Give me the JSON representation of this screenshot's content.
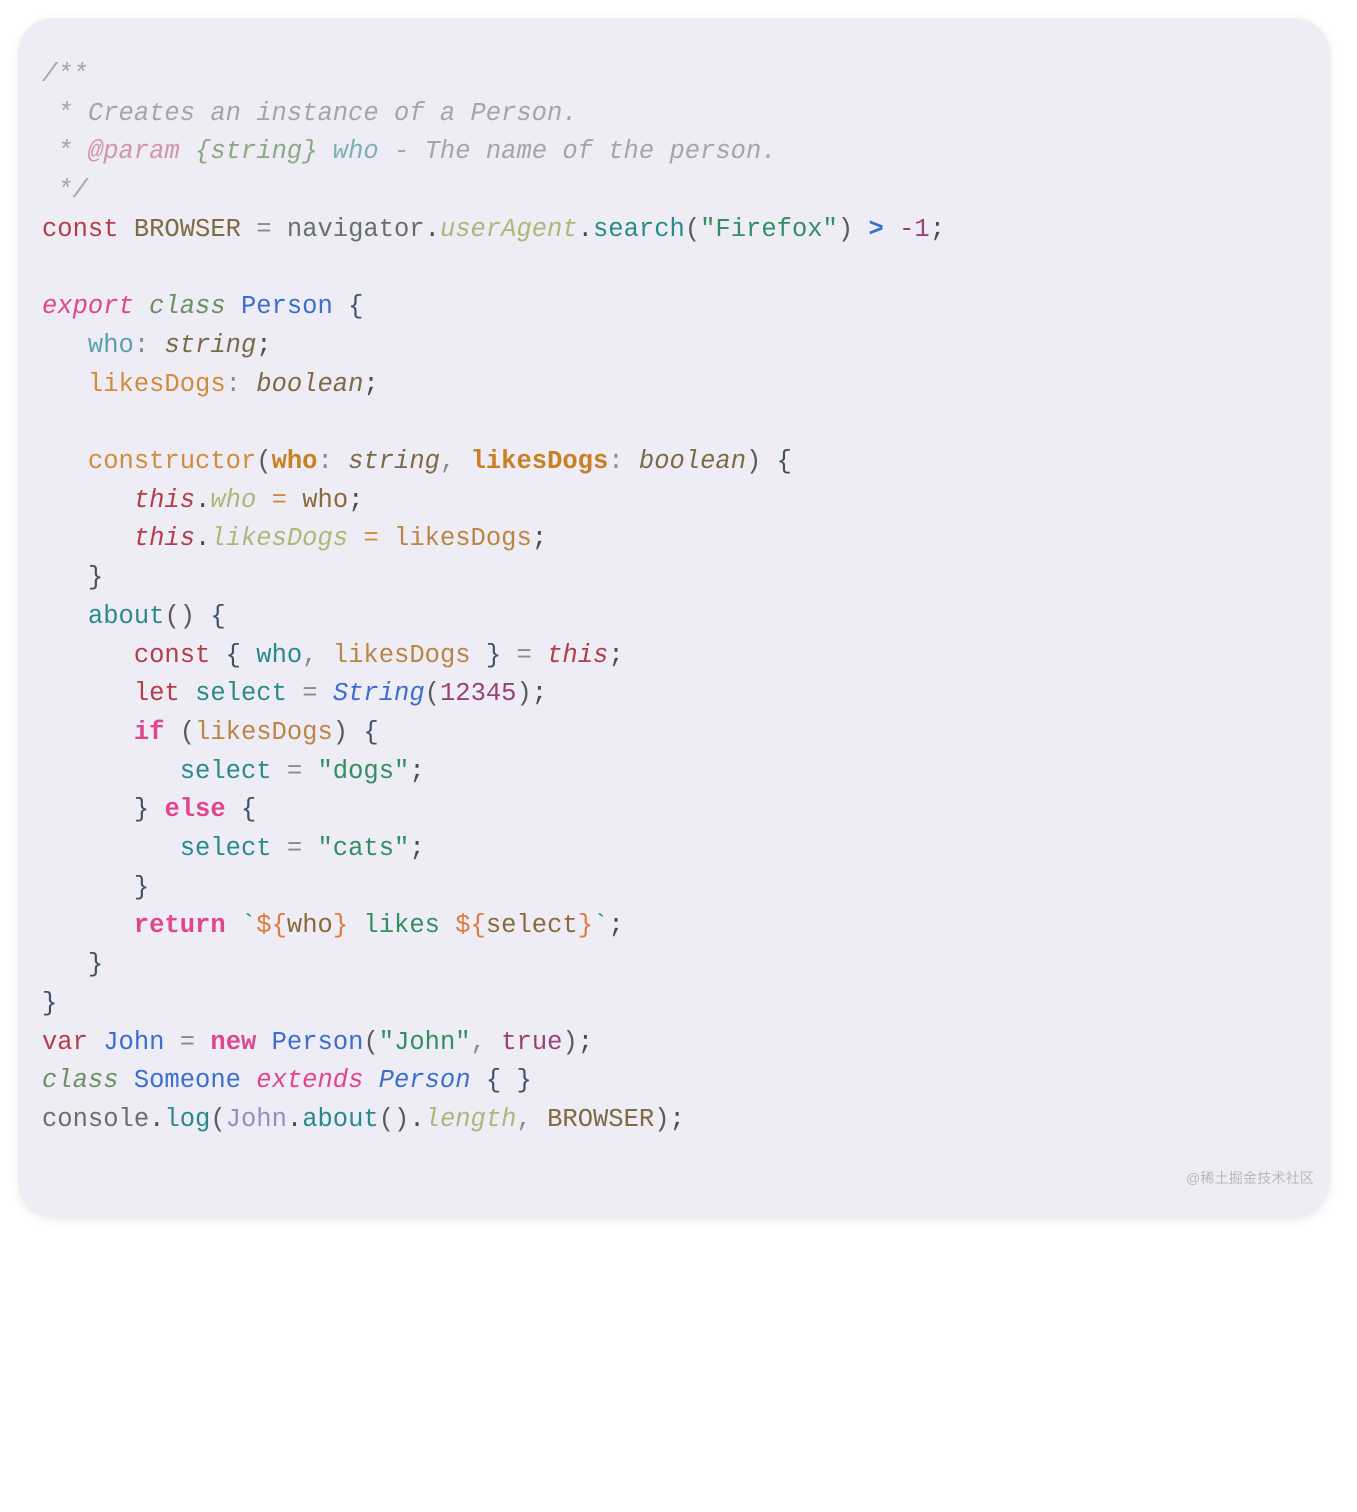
{
  "watermark": "@稀土掘金技术社区",
  "code": {
    "l1": {
      "a": "/**"
    },
    "l2": {
      "a": " * Creates an instance of a Person."
    },
    "l3": {
      "a": " * ",
      "b": "@param",
      "c": " ",
      "d": "{string}",
      "e": " ",
      "f": "who",
      "g": " - The name of the person."
    },
    "l4": {
      "a": " */"
    },
    "l5": {
      "a": "const",
      "b": " ",
      "c": "BROWSER",
      "d": " ",
      "e": "=",
      "f": " ",
      "g": "navigator",
      "h": ".",
      "i": "userAgent",
      "j": ".",
      "k": "search",
      "l": "(",
      "m": "\"Firefox\"",
      "n": ")",
      "o": " ",
      "p": ">",
      "q": " ",
      "r": "-",
      "s": "1",
      "t": ";"
    },
    "l6": {
      "a": ""
    },
    "l7": {
      "a": "export",
      "b": " ",
      "c": "class",
      "d": " ",
      "e": "Person",
      "f": " ",
      "g": "{"
    },
    "l8": {
      "a": "   ",
      "b": "who",
      "c": ":",
      "d": " ",
      "e": "string",
      "f": ";"
    },
    "l9": {
      "a": "   ",
      "b": "likesDogs",
      "c": ":",
      "d": " ",
      "e": "boolean",
      "f": ";"
    },
    "l10": {
      "a": ""
    },
    "l11": {
      "a": "   ",
      "b": "constructor",
      "c": "(",
      "d": "who",
      "e": ":",
      "f": " ",
      "g": "string",
      "h": ",",
      "i": " ",
      "j": "likesDogs",
      "k": ":",
      "l": " ",
      "m": "boolean",
      "n": ")",
      "o": " ",
      "p": "{"
    },
    "l12": {
      "a": "      ",
      "b": "this",
      "c": ".",
      "d": "who",
      "e": " ",
      "f": "=",
      "g": " ",
      "h": "who",
      "i": ";"
    },
    "l13": {
      "a": "      ",
      "b": "this",
      "c": ".",
      "d": "likesDogs",
      "e": " ",
      "f": "=",
      "g": " ",
      "h": "likesDogs",
      "i": ";"
    },
    "l14": {
      "a": "   ",
      "b": "}"
    },
    "l15": {
      "a": "   ",
      "b": "about",
      "c": "()",
      "d": " ",
      "e": "{"
    },
    "l16": {
      "a": "      ",
      "b": "const",
      "c": " ",
      "d": "{",
      "e": " ",
      "f": "who",
      "g": ",",
      "h": " ",
      "i": "likesDogs",
      "j": " ",
      "k": "}",
      "l": " ",
      "m": "=",
      "n": " ",
      "o": "this",
      "p": ";"
    },
    "l17": {
      "a": "      ",
      "b": "let",
      "c": " ",
      "d": "select",
      "e": " ",
      "f": "=",
      "g": " ",
      "h": "String",
      "i": "(",
      "j": "12345",
      "k": ")",
      "l": ";"
    },
    "l18": {
      "a": "      ",
      "b": "if",
      "c": " (",
      "d": "likesDogs",
      "e": ") ",
      "f": "{"
    },
    "l19": {
      "a": "         ",
      "b": "select",
      "c": " ",
      "d": "=",
      "e": " ",
      "f": "\"dogs\"",
      "g": ";"
    },
    "l20": {
      "a": "      ",
      "b": "}",
      "c": " ",
      "d": "else",
      "e": " ",
      "f": "{"
    },
    "l21": {
      "a": "         ",
      "b": "select",
      "c": " ",
      "d": "=",
      "e": " ",
      "f": "\"cats\"",
      "g": ";"
    },
    "l22": {
      "a": "      ",
      "b": "}"
    },
    "l23": {
      "a": "      ",
      "b": "return",
      "c": " ",
      "d": "`",
      "e": "${",
      "f": "who",
      "g": "}",
      "h": " likes ",
      "i": "${",
      "j": "select",
      "k": "}",
      "l": "`",
      "m": ";"
    },
    "l24": {
      "a": "   ",
      "b": "}"
    },
    "l25": {
      "a": "}"
    },
    "l26": {
      "a": "var",
      "b": " ",
      "c": "John",
      "d": " ",
      "e": "=",
      "f": " ",
      "g": "new",
      "h": " ",
      "i": "Person",
      "j": "(",
      "k": "\"John\"",
      "l": ",",
      "m": " ",
      "n": "true",
      "o": ")",
      "p": ";"
    },
    "l27": {
      "a": "class",
      "b": " ",
      "c": "Someone",
      "d": " ",
      "e": "extends",
      "f": " ",
      "g": "Person",
      "h": " ",
      "i": "{",
      "j": " ",
      "k": "}"
    },
    "l28": {
      "a": "console",
      "b": ".",
      "c": "log",
      "d": "(",
      "e": "John",
      "f": ".",
      "g": "about",
      "h": "()",
      "i": ".",
      "j": "length",
      "k": ",",
      "l": " ",
      "m": "BROWSER",
      "n": ")",
      "o": ";"
    }
  }
}
